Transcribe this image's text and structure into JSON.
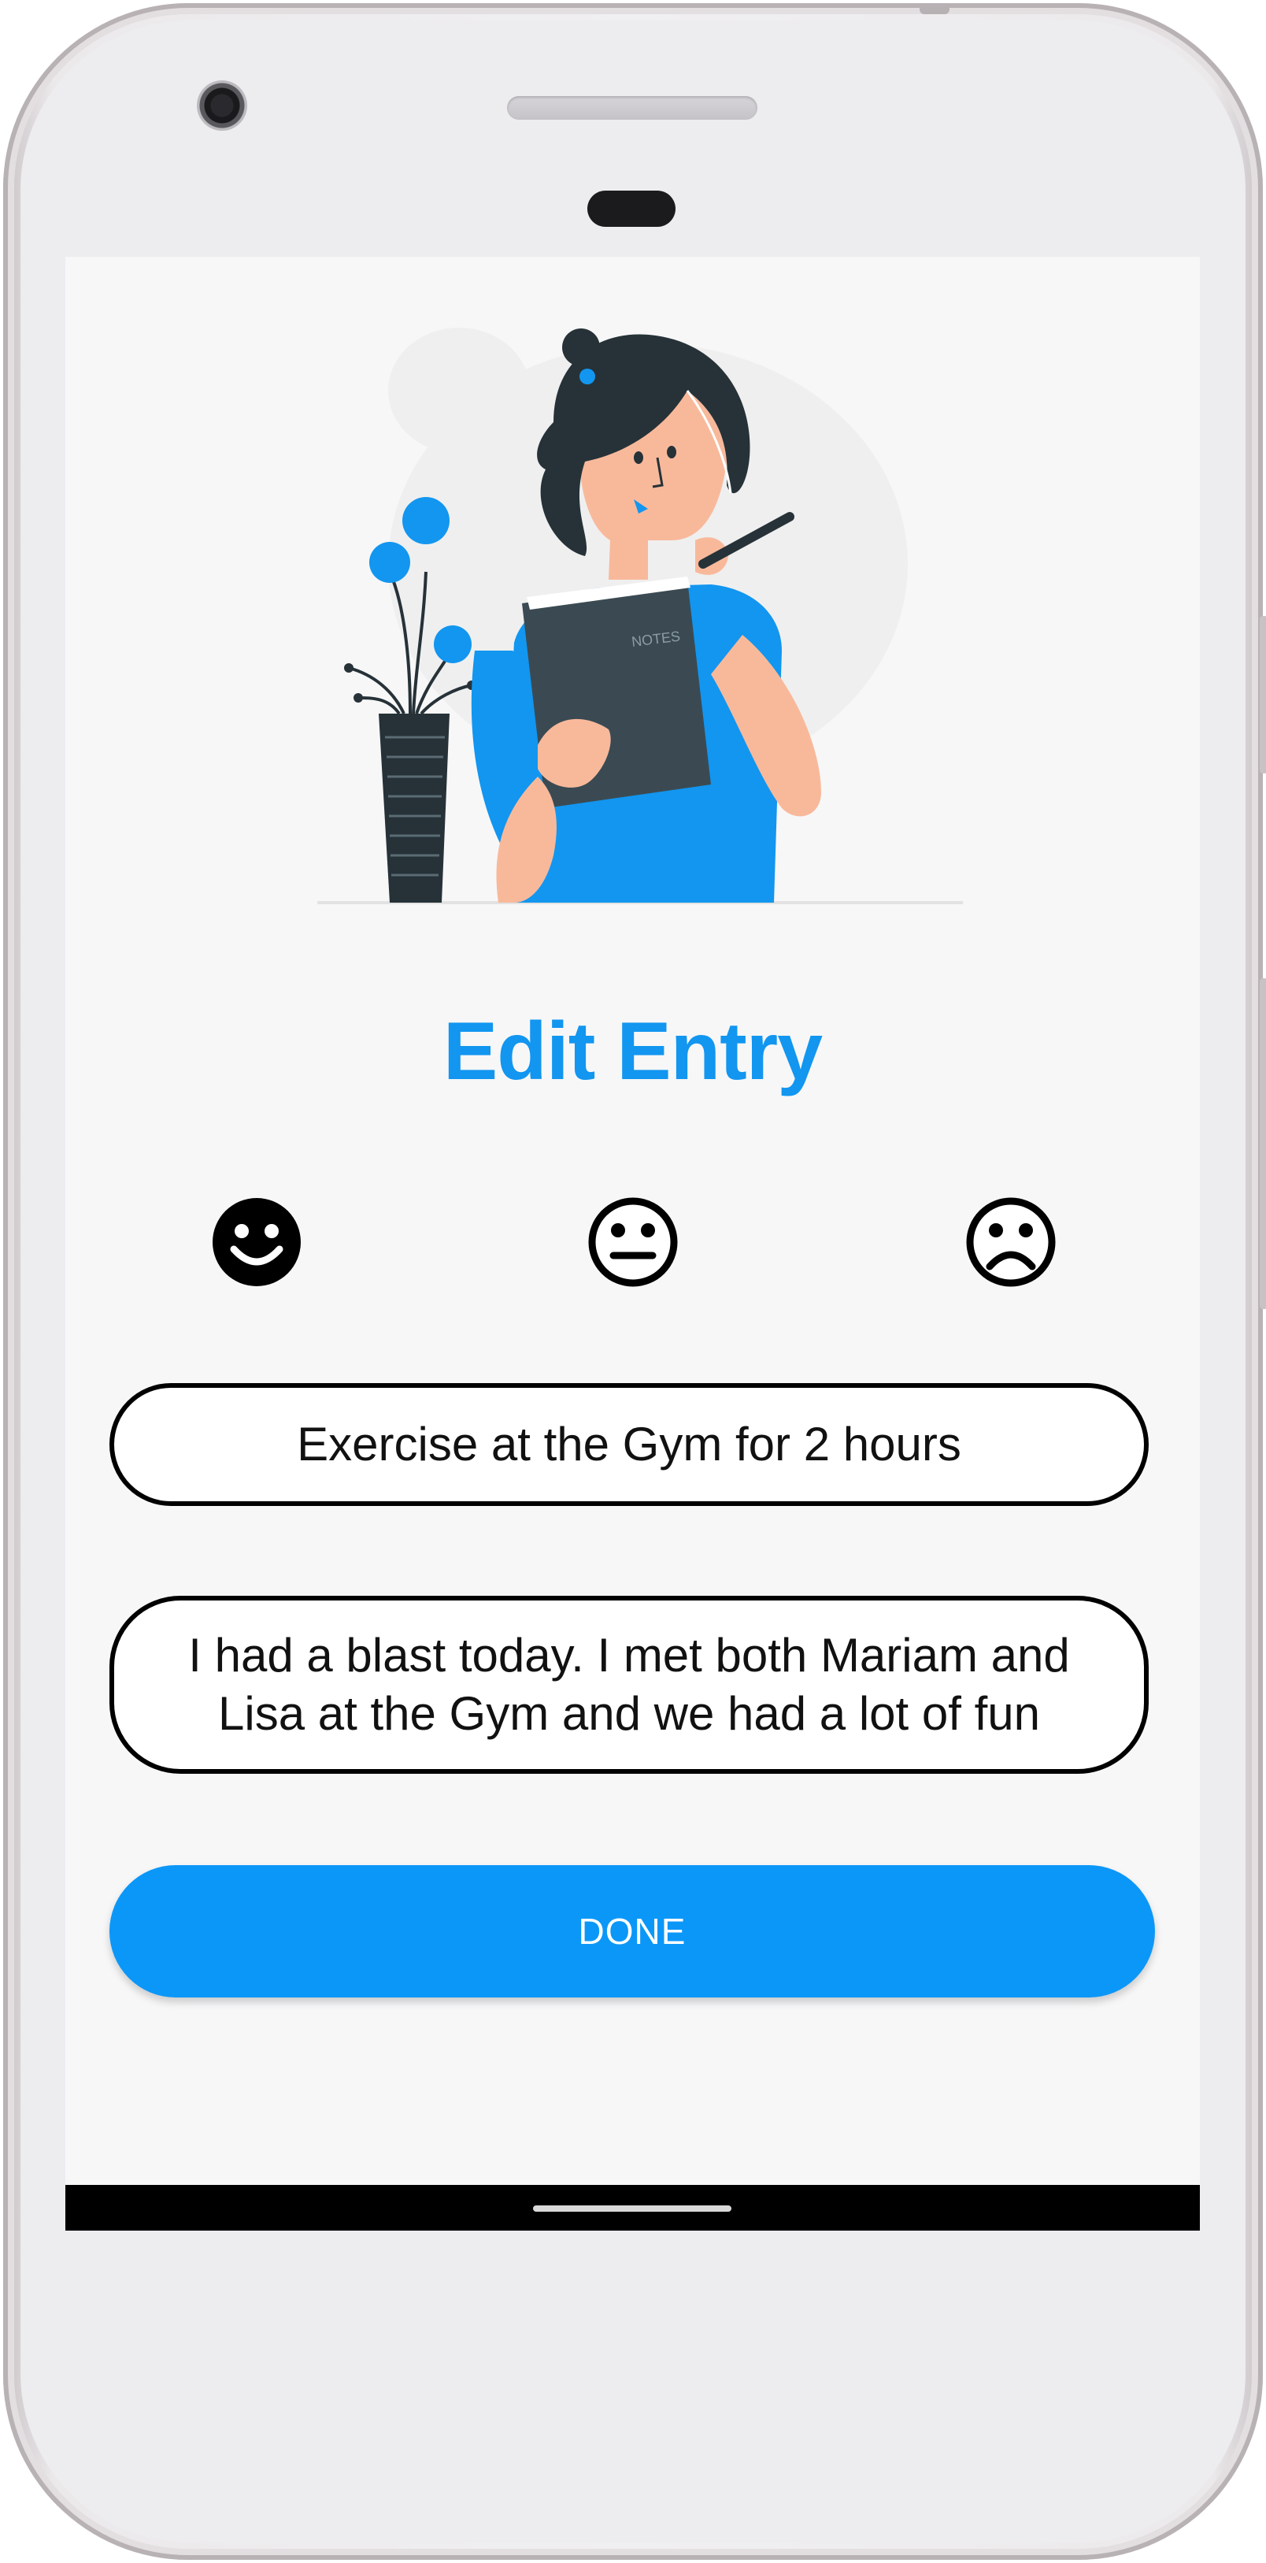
{
  "screen": {
    "title": "Edit Entry",
    "moods": [
      {
        "name": "happy",
        "icon": "happy-face-icon",
        "selected": true
      },
      {
        "name": "neutral",
        "icon": "neutral-face-icon",
        "selected": false
      },
      {
        "name": "sad",
        "icon": "sad-face-icon",
        "selected": false
      }
    ],
    "entry_title": "Exercise at the Gym for 2 hours",
    "entry_body": "I had a blast today. I met both Mariam and Lisa at the Gym and we had a lot of fun",
    "done_label": "DONE",
    "illustration_label": "NOTES"
  },
  "colors": {
    "accent": "#1296f0",
    "button": "#0b97f8",
    "screen_background": "#f7f7f8"
  }
}
